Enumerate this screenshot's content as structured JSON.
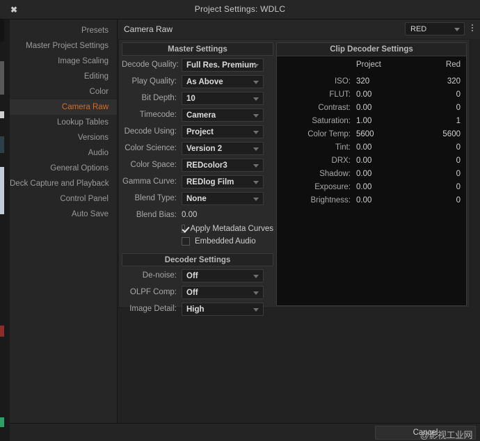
{
  "window": {
    "title": "Project Settings: WDLC",
    "close_label": "✖"
  },
  "sidebar": {
    "items": [
      {
        "label": "Presets",
        "active": false
      },
      {
        "label": "Master Project Settings",
        "active": false
      },
      {
        "label": "Image Scaling",
        "active": false
      },
      {
        "label": "Editing",
        "active": false
      },
      {
        "label": "Color",
        "active": false
      },
      {
        "label": "Camera Raw",
        "active": true
      },
      {
        "label": "Lookup Tables",
        "active": false
      },
      {
        "label": "Versions",
        "active": false
      },
      {
        "label": "Audio",
        "active": false
      },
      {
        "label": "General Options",
        "active": false
      },
      {
        "label": "Deck Capture and Playback",
        "active": false
      },
      {
        "label": "Control Panel",
        "active": false
      },
      {
        "label": "Auto Save",
        "active": false
      }
    ]
  },
  "content": {
    "title": "Camera Raw",
    "camera_select": {
      "value": "RED"
    },
    "master_settings": {
      "panel_title": "Master Settings",
      "rows": [
        {
          "label": "Decode Quality:",
          "value": "Full Res. Premium"
        },
        {
          "label": "Play Quality:",
          "value": "As Above"
        },
        {
          "label": "Bit Depth:",
          "value": "10"
        },
        {
          "label": "Timecode:",
          "value": "Camera"
        },
        {
          "label": "Decode Using:",
          "value": "Project"
        },
        {
          "label": "Color Science:",
          "value": "Version 2"
        },
        {
          "label": "Color Space:",
          "value": "REDcolor3"
        },
        {
          "label": "Gamma Curve:",
          "value": "REDlog Film"
        },
        {
          "label": "Blend Type:",
          "value": "None"
        }
      ],
      "blend_bias": {
        "label": "Blend Bias:",
        "value": "0.00"
      },
      "checkboxes": [
        {
          "label": "Apply Metadata Curves",
          "checked": true
        },
        {
          "label": "Embedded Audio",
          "checked": false
        }
      ]
    },
    "decoder_settings": {
      "panel_title": "Decoder Settings",
      "rows": [
        {
          "label": "De-noise:",
          "value": "Off"
        },
        {
          "label": "OLPF Comp:",
          "value": "Off"
        },
        {
          "label": "Image Detail:",
          "value": "High"
        }
      ]
    },
    "clip_decoder_settings": {
      "panel_title": "Clip Decoder Settings",
      "columns": {
        "project": "Project",
        "red": "Red"
      },
      "rows": [
        {
          "label": "ISO:",
          "project": "320",
          "red": "320"
        },
        {
          "label": "FLUT:",
          "project": "0.00",
          "red": "0"
        },
        {
          "label": "Contrast:",
          "project": "0.00",
          "red": "0"
        },
        {
          "label": "Saturation:",
          "project": "1.00",
          "red": "1"
        },
        {
          "label": "Color Temp:",
          "project": "5600",
          "red": "5600"
        },
        {
          "label": "Tint:",
          "project": "0.00",
          "red": "0"
        },
        {
          "label": "DRX:",
          "project": "0.00",
          "red": "0"
        },
        {
          "label": "Shadow:",
          "project": "0.00",
          "red": "0"
        },
        {
          "label": "Exposure:",
          "project": "0.00",
          "red": "0"
        },
        {
          "label": "Brightness:",
          "project": "0.00",
          "red": "0"
        }
      ]
    }
  },
  "footer": {
    "cancel_label": "Cancel",
    "watermark": "@影视工业网"
  },
  "colors": {
    "accent": "#d96b21",
    "panel_bg": "#2a2a2a",
    "clip_bg": "#0e0e0e"
  }
}
